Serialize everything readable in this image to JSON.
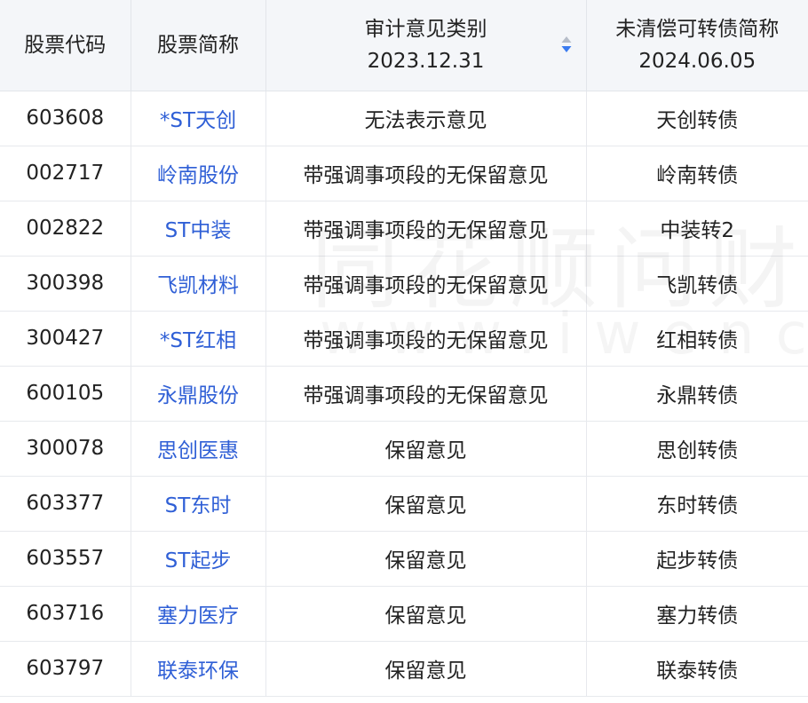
{
  "header": {
    "code": "股票代码",
    "name": "股票简称",
    "opinion_line1": "审计意见类别",
    "opinion_line2": "2023.12.31",
    "bond_line1": "未清偿可转债简称",
    "bond_line2": "2024.06.05"
  },
  "icons": {
    "sort": "sort-arrows-icon",
    "sort_up_color": "#b6bdc9",
    "sort_down_color": "#3a7bf0"
  },
  "colors": {
    "link": "#2f5fd6",
    "header_bg": "#f4f6f9"
  },
  "watermark": {
    "big": "同花顺问财",
    "small": "www.iwencai.com"
  },
  "rows": [
    {
      "code": "603608",
      "name": "*ST天创",
      "opinion": "无法表示意见",
      "bond": "天创转债"
    },
    {
      "code": "002717",
      "name": "岭南股份",
      "opinion": "带强调事项段的无保留意见",
      "bond": "岭南转债"
    },
    {
      "code": "002822",
      "name": "ST中装",
      "opinion": "带强调事项段的无保留意见",
      "bond": "中装转2"
    },
    {
      "code": "300398",
      "name": "飞凯材料",
      "opinion": "带强调事项段的无保留意见",
      "bond": "飞凯转债"
    },
    {
      "code": "300427",
      "name": "*ST红相",
      "opinion": "带强调事项段的无保留意见",
      "bond": "红相转债"
    },
    {
      "code": "600105",
      "name": "永鼎股份",
      "opinion": "带强调事项段的无保留意见",
      "bond": "永鼎转债"
    },
    {
      "code": "300078",
      "name": "思创医惠",
      "opinion": "保留意见",
      "bond": "思创转债"
    },
    {
      "code": "603377",
      "name": "ST东时",
      "opinion": "保留意见",
      "bond": "东时转债"
    },
    {
      "code": "603557",
      "name": "ST起步",
      "opinion": "保留意见",
      "bond": "起步转债"
    },
    {
      "code": "603716",
      "name": "塞力医疗",
      "opinion": "保留意见",
      "bond": "塞力转债"
    },
    {
      "code": "603797",
      "name": "联泰环保",
      "opinion": "保留意见",
      "bond": "联泰转债"
    }
  ]
}
